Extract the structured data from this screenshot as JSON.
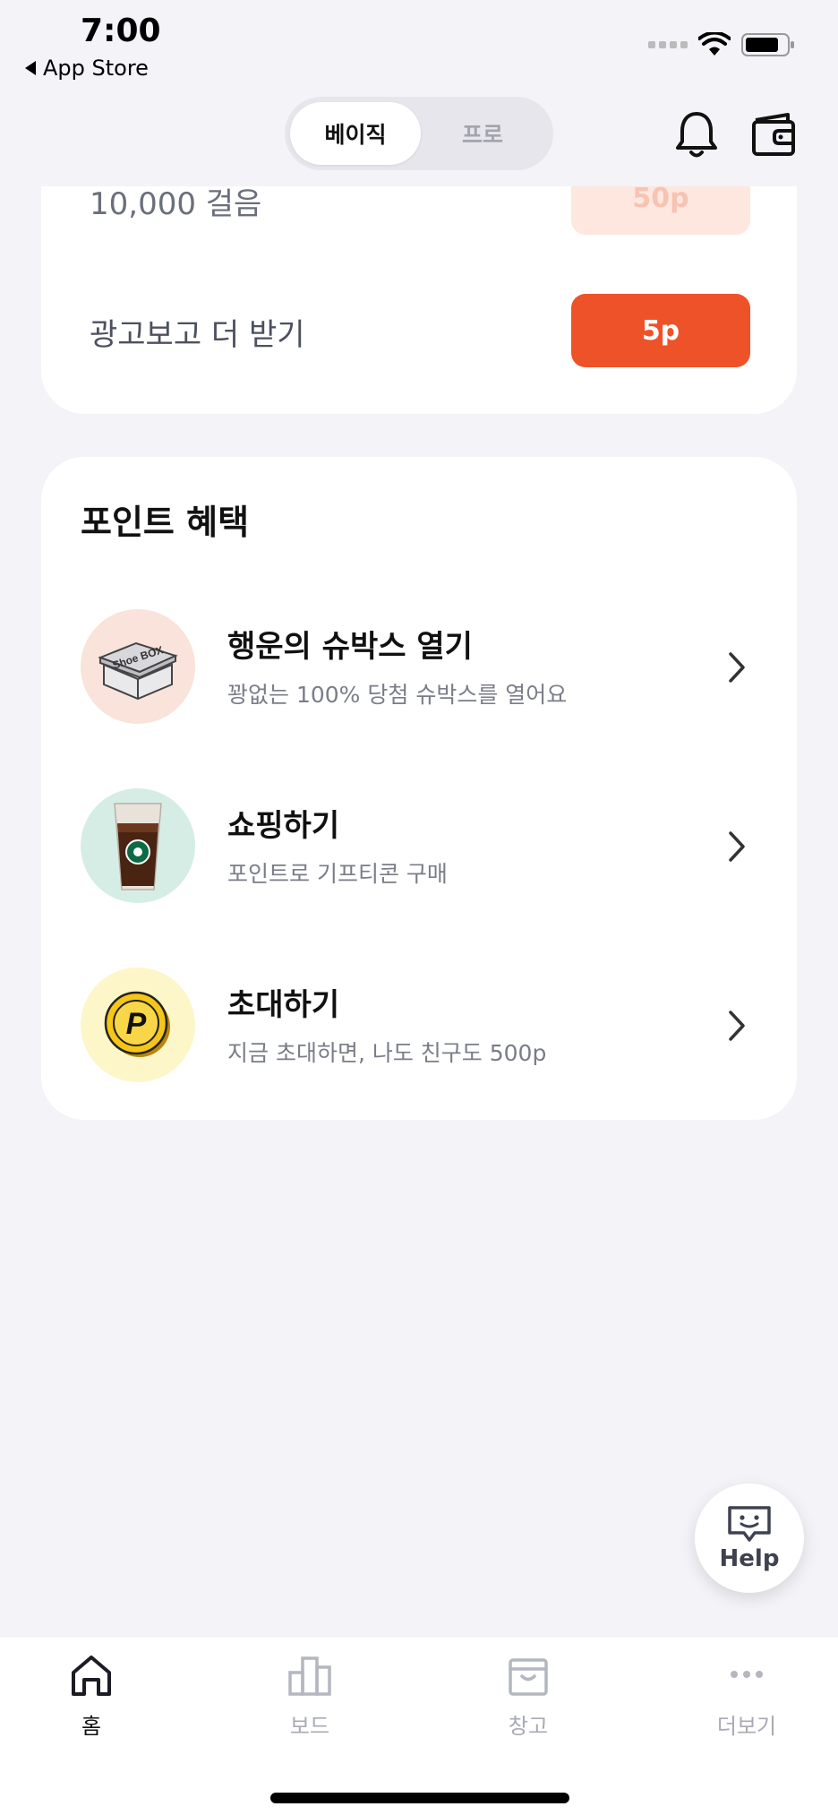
{
  "status": {
    "time": "7:00",
    "back_label": "App Store"
  },
  "header": {
    "seg_basic": "베이직",
    "seg_pro": "프로"
  },
  "steps_card": {
    "row1_label": "10,000 걸음",
    "row1_points": "50p",
    "row2_label": "광고보고 더 받기",
    "row2_points": "5p"
  },
  "benefits": {
    "title": "포인트 혜택",
    "items": [
      {
        "title": "행운의 슈박스 열기",
        "subtitle": "꽝없는 100% 당첨 슈박스를 열어요",
        "image_text": "Shoe BOX"
      },
      {
        "title": "쇼핑하기",
        "subtitle": "포인트로 기프티콘 구매"
      },
      {
        "title": "초대하기",
        "subtitle": "지금 초대하면, 나도 친구도 500p",
        "coin_letter": "P"
      }
    ]
  },
  "help": {
    "label": "Help"
  },
  "tabbar": {
    "tabs": [
      {
        "label": "홈",
        "icon": "home-icon"
      },
      {
        "label": "보드",
        "icon": "chart-icon"
      },
      {
        "label": "창고",
        "icon": "box-icon"
      },
      {
        "label": "더보기",
        "icon": "more-icon"
      }
    ]
  },
  "colors": {
    "accent": "#ee5228",
    "accent_faded": "#fde7df",
    "background": "#f3f3f8"
  }
}
